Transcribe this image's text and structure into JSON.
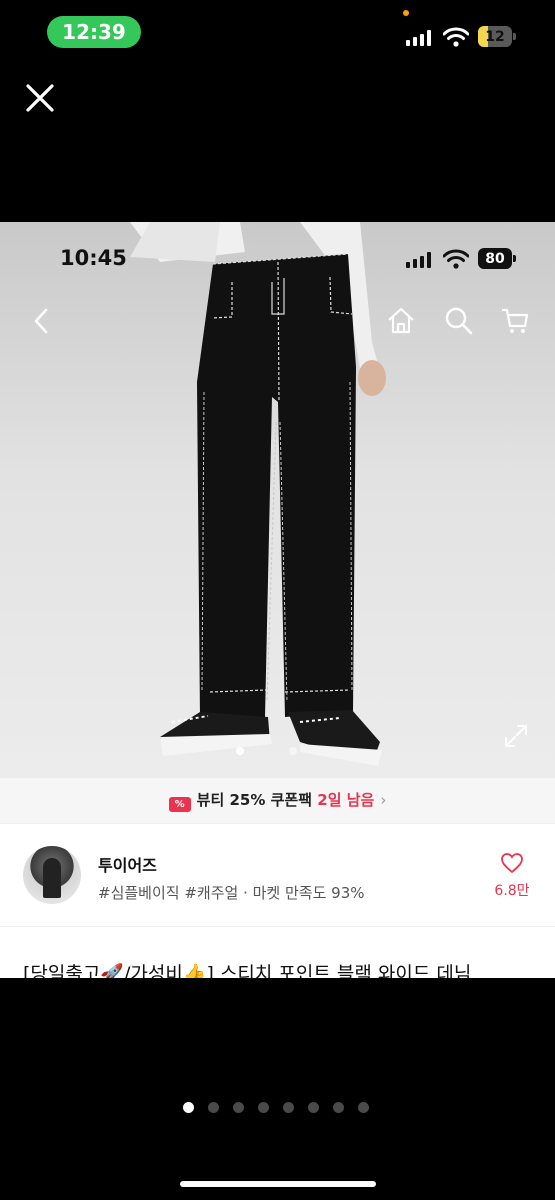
{
  "status_bar": {
    "time": "12:39",
    "battery": "12"
  },
  "inner_status_bar": {
    "time": "10:45",
    "battery": "80"
  },
  "icons": {
    "close": "close-icon",
    "back": "chevron-left-icon",
    "home": "home-icon",
    "search": "search-icon",
    "cart": "cart-icon",
    "expand": "expand-icon",
    "coupon": "coupon-icon",
    "like": "heart-icon"
  },
  "coupon_banner": {
    "text": "뷰티 25% 쿠폰팩",
    "days": "2일 남음",
    "chevron": "›"
  },
  "shop": {
    "name": "투이어즈",
    "tags": "#심플베이직 #캐주얼 · 마켓 만족도 93%",
    "likes": "6.8만"
  },
  "product": {
    "title": "[당일출고🚀/가성비👍] 스티치 포인트 블랙 와이드 데님"
  },
  "photo_carousel": {
    "count": 2,
    "active": 0
  },
  "pager": {
    "count": 8,
    "active": 0
  },
  "colors": {
    "accent": "#e8344e",
    "status_pill": "#34c759",
    "battery_low": "#f2d64b"
  }
}
